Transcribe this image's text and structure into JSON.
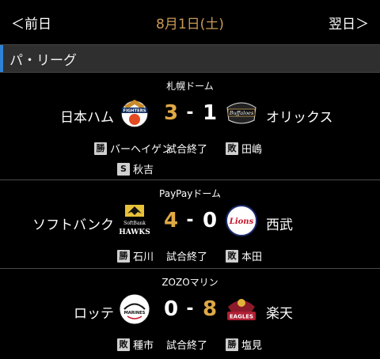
{
  "nav": {
    "prev": "＜前日",
    "date": "8月1日(土)",
    "next": "翌日＞"
  },
  "league": {
    "name": "パ・リーグ"
  },
  "games": [
    {
      "stadium": "札幌ドーム",
      "home": {
        "name": "日本ハム",
        "score": "3",
        "logo": "fighters-logo"
      },
      "away": {
        "name": "オリックス",
        "score": "1",
        "logo": "buffaloes-logo"
      },
      "status": "試合終了",
      "left_pitcher": {
        "badge": "勝",
        "name": "バーヘイゲン"
      },
      "right_pitcher": {
        "badge": "敗",
        "name": "田嶋"
      },
      "save_pitcher": {
        "badge": "S",
        "name": "秋吉"
      }
    },
    {
      "stadium": "PayPayドーム",
      "home": {
        "name": "ソフトバンク",
        "score": "4",
        "logo": "hawks-logo"
      },
      "away": {
        "name": "西武",
        "score": "0",
        "logo": "lions-logo"
      },
      "status": "試合終了",
      "left_pitcher": {
        "badge": "勝",
        "name": "石川"
      },
      "right_pitcher": {
        "badge": "敗",
        "name": "本田"
      }
    },
    {
      "stadium": "ZOZOマリン",
      "home": {
        "name": "ロッテ",
        "score": "0",
        "logo": "marines-logo"
      },
      "away": {
        "name": "楽天",
        "score": "8",
        "logo": "eagles-logo"
      },
      "status": "試合終了",
      "left_pitcher": {
        "badge": "敗",
        "name": "種市"
      },
      "right_pitcher": {
        "badge": "勝",
        "name": "塩見"
      }
    }
  ],
  "colors": {
    "date": "#c99a57",
    "winning_score": "#dfa945",
    "league_accent": "#2f83d6",
    "header_bg": "#2f2f2f"
  },
  "logo_text": {
    "fighters": "FIGHTERS",
    "buffaloes": "Buffaloes",
    "hawks_top": "SoftBank",
    "hawks_bottom": "HAWKS",
    "lions": "Lions",
    "marines": "MARINES",
    "eagles": "EAGLES"
  }
}
